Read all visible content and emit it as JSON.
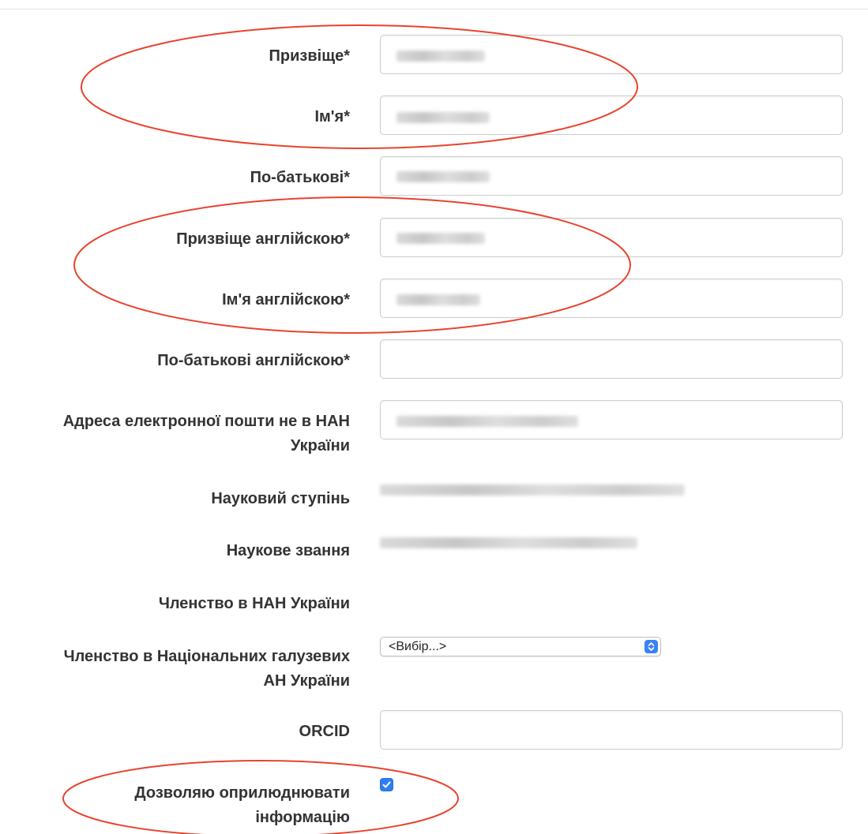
{
  "form": {
    "surname_label": "Призвіще*",
    "name_label": "Ім'я*",
    "patronymic_label": "По-батькові*",
    "surname_en_label": "Призвіще англійскою*",
    "name_en_label": "Ім'я англійскою*",
    "patronymic_en_label": "По-батькові англійскою*",
    "email_label_line1": "Адреса електронної пошти не в НАН",
    "email_label_line2": "України",
    "degree_label": "Науковий ступінь",
    "title_label": "Наукове звання",
    "nas_membership_label": "Членство в НАН України",
    "branch_membership_label_line1": "Членство в Національних галузевих",
    "branch_membership_label_line2": "АН України",
    "branch_membership_select_value": "<Вибір...>",
    "orcid_label": "ORCID",
    "consent_label_line1": "Дозволяю оприлюднювати",
    "consent_label_line2": "інформацію",
    "consent_checked": true
  },
  "colors": {
    "annotation_ellipse": "#e8432e",
    "checkbox_blue": "#2f7cf6"
  }
}
